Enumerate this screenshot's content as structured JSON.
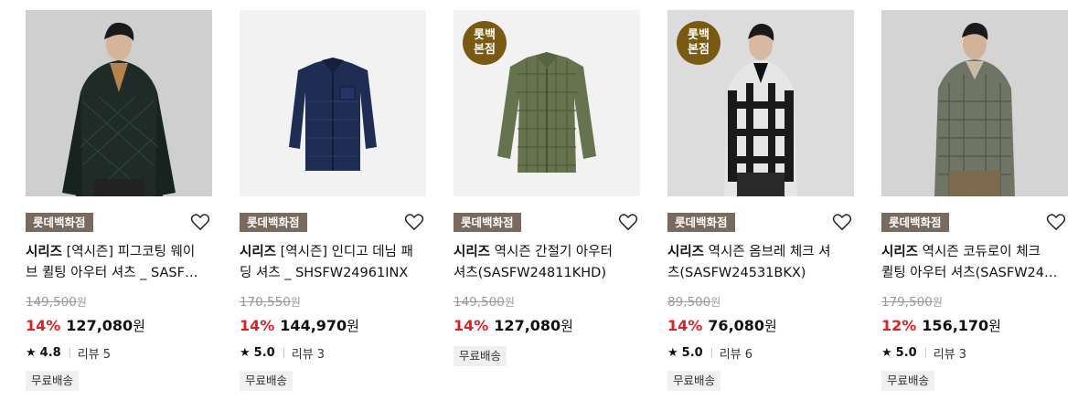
{
  "products": [
    {
      "store": "롯데백화점",
      "brand": "시리즈",
      "name": " [역시즌] 피그코팅 웨이브 퀼팅 아우터 셔츠 _ SASF…",
      "line1": " [역시즌] 피그코팅 웨이",
      "line2": "브 퀼팅 아우터 셔츠 _ SASF…",
      "original_price": "149,500",
      "original_unit": "원",
      "discount": "14%",
      "price": "127,080",
      "price_unit": "원",
      "rating": "4.8",
      "review": "리뷰 5",
      "shipping": "무료배송",
      "badge": ""
    },
    {
      "store": "롯데백화점",
      "brand": "시리즈",
      "line1": " [역시즌] 인디고 데님 패",
      "line2": "딩 셔츠 _ SHSFW24961INX",
      "original_price": "170,550",
      "original_unit": "원",
      "discount": "14%",
      "price": "144,970",
      "price_unit": "원",
      "rating": "5.0",
      "review": "리뷰 3",
      "shipping": "무료배송",
      "badge": ""
    },
    {
      "store": "롯데백화점",
      "brand": "시리즈",
      "line1": " 역시즌 간절기 아우터",
      "line2": "셔츠(SASFW24811KHD)",
      "original_price": "149,500",
      "original_unit": "원",
      "discount": "14%",
      "price": "127,080",
      "price_unit": "원",
      "rating": "",
      "review": "",
      "shipping": "무료배송",
      "badge_line1": "롯백",
      "badge_line2": "본점"
    },
    {
      "store": "롯데백화점",
      "brand": "시리즈",
      "line1": " 역시즌 옴브레 체크 셔",
      "line2": "츠(SASFW24531BKX)",
      "original_price": "89,500",
      "original_unit": "원",
      "discount": "14%",
      "price": "76,080",
      "price_unit": "원",
      "rating": "5.0",
      "review": "리뷰 6",
      "shipping": "무료배송",
      "badge_line1": "롯백",
      "badge_line2": "본점"
    },
    {
      "store": "롯데백화점",
      "brand": "시리즈",
      "line1": " 역시즌 코듀로이 체크",
      "line2": "퀼팅 아우터 셔츠(SASFW24…",
      "original_price": "179,500",
      "original_unit": "원",
      "discount": "12%",
      "price": "156,170",
      "price_unit": "원",
      "rating": "5.0",
      "review": "리뷰 3",
      "shipping": "무료배송",
      "badge": ""
    }
  ],
  "colors": {
    "discount": "#e02020",
    "store_tag": "#7a6a5d",
    "badge": "#7a5a12",
    "shipping_bg": "#f0f0f0"
  },
  "icons": [
    "heart-outline-icon",
    "star-icon"
  ]
}
